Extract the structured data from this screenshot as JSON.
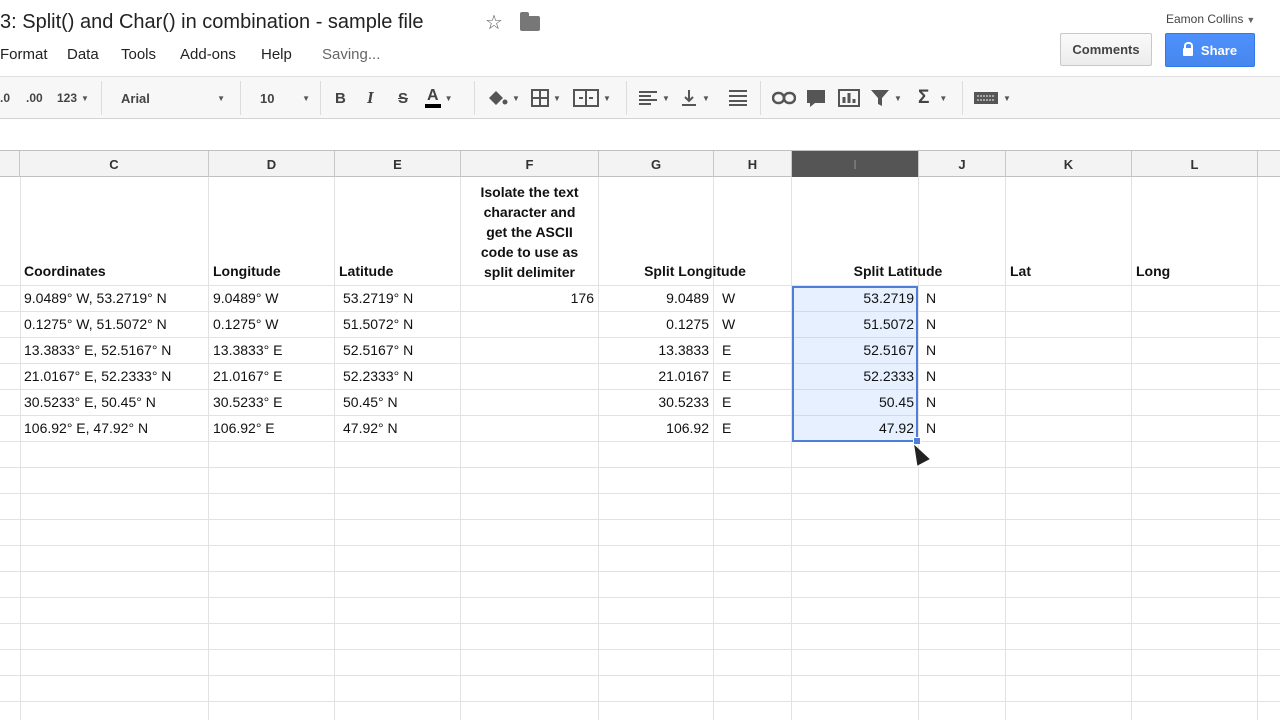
{
  "title_bar": {
    "doc_title": "3: Split() and Char() in combination - sample file",
    "user_name": "Eamon Collins",
    "comments_label": "Comments",
    "share_label": "Share",
    "star_icon": "star-icon",
    "folder_icon": "folder-icon",
    "lock_icon": "lock-icon"
  },
  "menu": {
    "items": [
      "Format",
      "Data",
      "Tools",
      "Add-ons",
      "Help"
    ],
    "status": "Saving..."
  },
  "toolbar": {
    "decimal_decrease": ".0",
    "decimal_increase": ".00",
    "number_format": "123",
    "font": "Arial",
    "font_size": "10",
    "bold": "B",
    "italic": "I",
    "strike": "S",
    "text_color": "A",
    "sum": "Σ"
  },
  "columns": [
    "C",
    "D",
    "E",
    "F",
    "G",
    "H",
    "I",
    "J",
    "K",
    "L"
  ],
  "header_row": {
    "c": "Coordinates",
    "d": "Longitude",
    "e": "Latitude",
    "f": "Isolate the text character and get the ASCII code to use as split delimiter",
    "f_lines": [
      "Isolate the text",
      "character and",
      "get the ASCII",
      "code to use as",
      "split delimiter"
    ],
    "g": "Split Longitude",
    "i": "Split Latitude",
    "k": "Lat",
    "l": "Long"
  },
  "rows": [
    {
      "c": "9.0489° W, 53.2719° N",
      "d": "9.0489° W",
      "e": "53.2719° N",
      "f": "176",
      "g": "9.0489",
      "h": "W",
      "i": "53.2719",
      "j": "N"
    },
    {
      "c": "0.1275° W, 51.5072° N",
      "d": "0.1275° W",
      "e": "51.5072° N",
      "f": "",
      "g": "0.1275",
      "h": "W",
      "i": "51.5072",
      "j": "N"
    },
    {
      "c": "13.3833° E, 52.5167° N",
      "d": "13.3833° E",
      "e": "52.5167° N",
      "f": "",
      "g": "13.3833",
      "h": "E",
      "i": "52.5167",
      "j": "N"
    },
    {
      "c": "21.0167° E, 52.2333° N",
      "d": "21.0167° E",
      "e": "52.2333° N",
      "f": "",
      "g": "21.0167",
      "h": "E",
      "i": "52.2333",
      "j": "N"
    },
    {
      "c": "30.5233° E, 50.45° N",
      "d": "30.5233° E",
      "e": "50.45° N",
      "f": "",
      "g": "30.5233",
      "h": "E",
      "i": "50.45",
      "j": "N"
    },
    {
      "c": "106.92° E, 47.92° N",
      "d": "106.92° E",
      "e": "47.92° N",
      "f": "",
      "g": "106.92",
      "h": "E",
      "i": "47.92",
      "j": "N"
    }
  ],
  "colors": {
    "share_blue": "#4d90fe",
    "selection_border": "#4d7fd6"
  }
}
